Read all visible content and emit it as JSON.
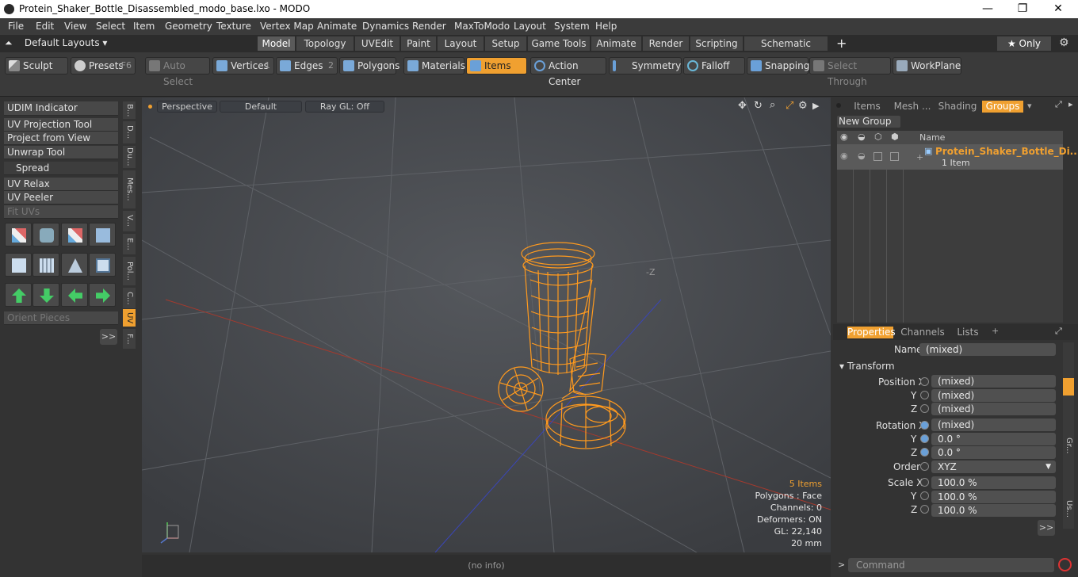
{
  "window": {
    "title": "Protein_Shaker_Bottle_Disassembled_modo_base.lxo - MODO",
    "min": "—",
    "max": "❐",
    "close": "✕"
  },
  "menu": [
    "File",
    "Edit",
    "View",
    "Select",
    "Item",
    "Geometry",
    "Texture",
    "Vertex Map",
    "Animate",
    "Dynamics",
    "Render",
    "MaxToModo",
    "Layout",
    "System",
    "Help"
  ],
  "layout": {
    "default_layouts": "Default Layouts ▾",
    "tabs": [
      "Model",
      "Topology",
      "UVEdit",
      "Paint",
      "Layout",
      "Setup",
      "Game Tools",
      "Animate",
      "Render",
      "Scripting",
      "Schematic Fusion"
    ],
    "add": "+",
    "only": "★  Only",
    "gear": "⚙"
  },
  "toolbar": {
    "sculpt": "Sculpt",
    "presets": "Presets",
    "presets_key": "F6",
    "auto_select": "Auto Select",
    "vertices": "Vertices",
    "vertices_n": "1",
    "edges": "Edges",
    "edges_n": "2",
    "polygons": "Polygons",
    "materials": "Materials",
    "items": "Items",
    "action_center": "Action Center",
    "symmetry": "Symmetry",
    "falloff": "Falloff",
    "snapping": "Snapping",
    "select_through": "Select Through",
    "workplane": "WorkPlane"
  },
  "left": {
    "udim": "UDIM Indicator",
    "uv_projection": "UV Projection Tool",
    "project_view": "Project from View",
    "unwrap": "Unwrap Tool",
    "spread": "Spread",
    "uv_relax": "UV Relax",
    "uv_peeler": "UV Peeler",
    "fit_uvs": "Fit UVs",
    "orient": "Orient Pieces",
    "more": ">>",
    "vtabs": [
      "B...",
      "D...",
      "Du...",
      "Mes...",
      "V...",
      "E...",
      "Pol...",
      "C...",
      "UV",
      "F..."
    ]
  },
  "viewport": {
    "perspective": "Perspective",
    "default": "Default",
    "raygl": "Ray GL: Off",
    "axis_label": "-Z",
    "stats": {
      "items": "5 Items",
      "polygons": "Polygons : Face",
      "channels": "Channels: 0",
      "deformers": "Deformers: ON",
      "gl": "GL: 22,140",
      "size": "20 mm"
    }
  },
  "status": "(no info)",
  "right": {
    "tabs": [
      "Items",
      "Mesh ...",
      "Shading",
      "Groups"
    ],
    "new_group": "New Group",
    "name_col": "Name",
    "group_name": "Protein_Shaker_Bottle_Di...",
    "group_sub": "1 Item",
    "prop_tabs": [
      "Properties",
      "Channels",
      "Lists"
    ],
    "name_label": "Name",
    "name_val": "(mixed)",
    "transform": "Transform",
    "position_x": "Position X",
    "y": "Y",
    "z": "Z",
    "rotation_x": "Rotation X",
    "order": "Order",
    "scale_x": "Scale X",
    "pos": [
      "(mixed)",
      "(mixed)",
      "(mixed)"
    ],
    "rot": [
      "(mixed)",
      "0.0 °",
      "0.0 °"
    ],
    "order_val": "XYZ",
    "scale": [
      "100.0 %",
      "100.0 %",
      "100.0 %"
    ],
    "more": ">>",
    "command": "Command",
    "side_tabs": [
      "Gr...",
      "Us..."
    ]
  },
  "colors": {
    "accent": "#f0a030",
    "wire": "#ff9a1e"
  }
}
